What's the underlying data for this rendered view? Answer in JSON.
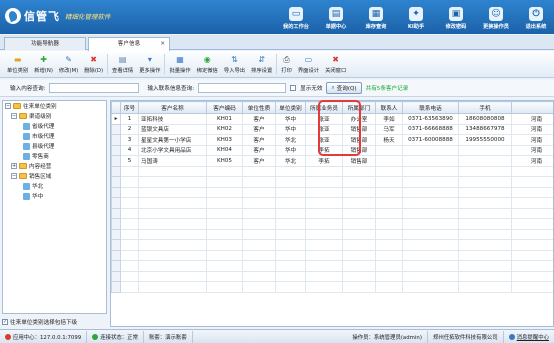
{
  "app": {
    "logo_name": "信管飞",
    "logo_tagline": "精细化管理软件"
  },
  "topnav": [
    {
      "label": "我的工作台",
      "icon": "monitor-icon",
      "glyph": "▭"
    },
    {
      "label": "单据中心",
      "icon": "document-icon",
      "glyph": "▤"
    },
    {
      "label": "库存查询",
      "icon": "warehouse-icon",
      "glyph": "▦"
    },
    {
      "label": "KI助手",
      "icon": "assistant-icon",
      "glyph": "✦"
    },
    {
      "label": "修改密码",
      "icon": "lock-icon",
      "glyph": "▣"
    },
    {
      "label": "更换操作员",
      "icon": "user-switch-icon",
      "glyph": "☺"
    },
    {
      "label": "退出系统",
      "icon": "exit-icon",
      "glyph": "⏻"
    }
  ],
  "tabs": {
    "nav": "功能导航器",
    "customer": "客户信息",
    "close_glyph": "✕"
  },
  "toolbar": [
    {
      "label": "单位类别",
      "icon": "category-icon",
      "glyph": "▬",
      "color": "#e0a21f"
    },
    {
      "label": "新增(N)",
      "icon": "add-icon",
      "glyph": "✚",
      "color": "#2fa63c"
    },
    {
      "label": "修改(M)",
      "icon": "edit-icon",
      "glyph": "✎",
      "color": "#3a78c4"
    },
    {
      "label": "删除(D)",
      "icon": "delete-icon",
      "glyph": "✖",
      "color": "#d83a2e"
    },
    {
      "label": "查看详情",
      "icon": "details-icon",
      "glyph": "▤",
      "color": "#5b7fa8"
    },
    {
      "label": "更多操作",
      "icon": "more-icon",
      "glyph": "▾",
      "color": "#3a78c4"
    },
    {
      "label": "批量操作",
      "icon": "batch-icon",
      "glyph": "▦",
      "color": "#3a78c4"
    },
    {
      "label": "绑定微信",
      "icon": "wechat-icon",
      "glyph": "◉",
      "color": "#2fa63c"
    },
    {
      "label": "导入导出",
      "icon": "import-export-icon",
      "glyph": "⇅",
      "color": "#3a78c4"
    },
    {
      "label": "排序设置",
      "icon": "sort-icon",
      "glyph": "⇵",
      "color": "#3a78c4"
    },
    {
      "label": "打印",
      "icon": "print-icon",
      "glyph": "⎙",
      "color": "#555555"
    },
    {
      "label": "界面设计",
      "icon": "design-icon",
      "glyph": "▭",
      "color": "#3a78c4"
    },
    {
      "label": "关闭窗口",
      "icon": "close-window-icon",
      "glyph": "✖",
      "color": "#d83a2e"
    }
  ],
  "search": {
    "label1": "输入内容查询:",
    "label2": "输入联系信息查询:",
    "show_invalid": "显示无效",
    "query_btn": "查询(Q)",
    "query_glyph": "⌕",
    "hint": "共有5条客户记录"
  },
  "tree": {
    "root": "往来单位类别",
    "items": [
      {
        "label": "渠道级别",
        "level": 1,
        "type": "folder",
        "exp": "−"
      },
      {
        "label": "省级代理",
        "level": 2,
        "type": "pic"
      },
      {
        "label": "市级代理",
        "level": 2,
        "type": "pic"
      },
      {
        "label": "县级代理",
        "level": 2,
        "type": "pic"
      },
      {
        "label": "零售商",
        "level": 2,
        "type": "pic"
      },
      {
        "label": "内容经营",
        "level": 1,
        "type": "folder",
        "exp": "+"
      },
      {
        "label": "销售区域",
        "level": 1,
        "type": "folder",
        "exp": "−"
      },
      {
        "label": "华北",
        "level": 2,
        "type": "pic"
      },
      {
        "label": "华中",
        "level": 2,
        "type": "pic"
      }
    ],
    "footer": "往来单位类别选择包括下级",
    "footer_check": "✓"
  },
  "grid": {
    "headers": [
      "序号",
      "客户名称",
      "客户编码",
      "单位性质",
      "单位类别",
      "所属业务员",
      "所属部门",
      "联系人",
      "联系电话",
      "手机",
      ""
    ],
    "rows": [
      [
        "1",
        "亚拓科技",
        "KH01",
        "客户",
        "华中",
        "张亚",
        "办公室",
        "李如",
        "0371-63563890",
        "18608080808",
        "河南"
      ],
      [
        "2",
        "蓝银文具店",
        "KH02",
        "客户",
        "华中",
        "张亚",
        "销售部",
        "马军",
        "0371-66668888",
        "13488667978",
        "河南"
      ],
      [
        "3",
        "星星文具第一小学店",
        "KH03",
        "客户",
        "华北",
        "张亚",
        "销售部",
        "杨天",
        "0371-60008888",
        "19955550000",
        "河南"
      ],
      [
        "4",
        "北京小学文具用品店",
        "KH04",
        "客户",
        "华中",
        "李拓",
        "销售部",
        "",
        "",
        "",
        "河南"
      ],
      [
        "5",
        "马国涛",
        "KH05",
        "客户",
        "华北",
        "李拓",
        "销售部",
        "",
        "",
        "",
        "河南"
      ]
    ],
    "row_marker": "▸"
  },
  "status": {
    "app": "应用中心：127.0.0.1:7099",
    "conn": "连接状态：正常",
    "account": "账套：演示账套",
    "operator": "操作员：系统管理员(admin)",
    "company": "郑州任拓软件科技有限公司",
    "msg": "消息提醒中心",
    "colors": {
      "app": "#d83a2e",
      "conn": "#2fa63c",
      "msg": "#3a78c4"
    }
  }
}
